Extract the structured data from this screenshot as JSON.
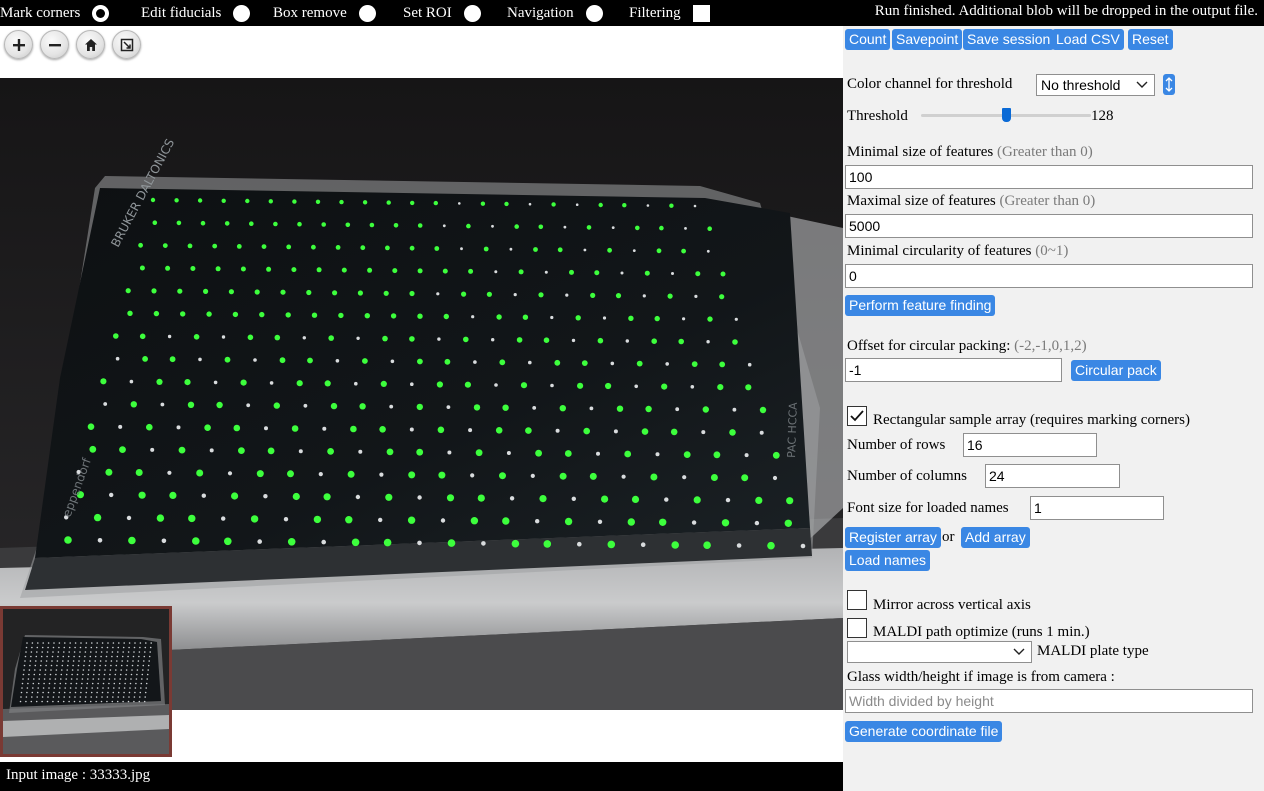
{
  "modes": [
    {
      "label": "Mark corners",
      "kind": "radio",
      "checked": true
    },
    {
      "label": "Edit fiducials",
      "kind": "radio",
      "checked": false
    },
    {
      "label": "Box remove",
      "kind": "radio",
      "checked": false
    },
    {
      "label": "Set ROI",
      "kind": "radio",
      "checked": false
    },
    {
      "label": "Navigation",
      "kind": "radio",
      "checked": false
    },
    {
      "label": "Filtering",
      "kind": "checkbox",
      "checked": false
    }
  ],
  "status": "Run finished. Additional blob will be dropped in the output file.",
  "zoom_tools": [
    "zoom-in-icon",
    "zoom-out-icon",
    "home-icon",
    "fit-screen-icon"
  ],
  "footer": {
    "text": "Input image : 33333.jpg"
  },
  "toolbar": {
    "count": "Count",
    "savepoint": "Savepoint",
    "save_session": "Save session",
    "load_csv": "Load CSV",
    "reset": "Reset"
  },
  "threshold": {
    "channel_label": "Color channel for threshold",
    "channel_value": "No threshold",
    "label": "Threshold",
    "value": "128",
    "slider_fraction": 0.5
  },
  "features": {
    "min_label": "Minimal size of features",
    "min_hint": "(Greater than 0)",
    "min_value": "100",
    "max_label": "Maximal size of features",
    "max_hint": "(Greater than 0)",
    "max_value": "5000",
    "circ_label": "Minimal circularity of features",
    "circ_hint": "(0~1)",
    "circ_value": "0",
    "perform": "Perform feature finding"
  },
  "packing": {
    "label": "Offset for circular packing:",
    "hint": "(-2,-1,0,1,2)",
    "value": "-1",
    "button": "Circular pack"
  },
  "array": {
    "rect_label": "Rectangular sample array (requires marking corners)",
    "rect_checked": true,
    "rows_label": "Number of rows",
    "rows_value": "16",
    "cols_label": "Number of columns",
    "cols_value": "24",
    "font_label": "Font size for loaded names",
    "font_value": "1",
    "register": "Register array",
    "or": "or",
    "add": "Add array",
    "load_names": "Load names"
  },
  "output": {
    "mirror_label": "Mirror across vertical axis",
    "maldi_label": "MALDI path optimize (runs 1 min.)",
    "plate_label": "MALDI plate type",
    "glass_label": "Glass width/height if image is from camera :",
    "glass_placeholder": "Width divided by height",
    "generate": "Generate coordinate file"
  },
  "colors": {
    "accent": "#3a87e4",
    "fiducial": "#3dff3d",
    "topbar": "#000000"
  }
}
